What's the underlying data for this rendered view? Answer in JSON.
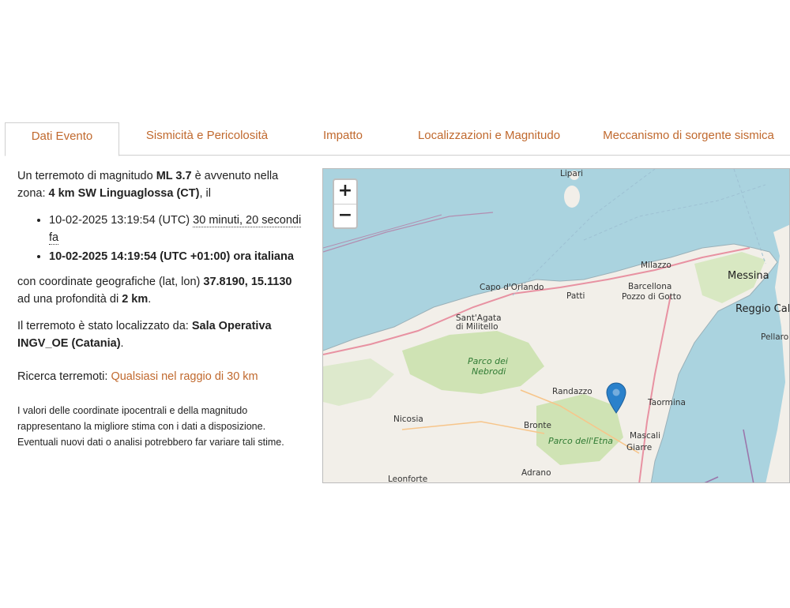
{
  "tabs": [
    {
      "label": "Dati Evento",
      "active": true
    },
    {
      "label": "Sismicità e Pericolosità",
      "active": false
    },
    {
      "label": "Impatto",
      "active": false
    },
    {
      "label": "Localizzazioni e Magnitudo",
      "active": false
    },
    {
      "label": "Meccanismo di sorgente sismica",
      "active": false
    }
  ],
  "event": {
    "intro_pre": "Un terremoto di magnitudo ",
    "magnitude": "ML 3.7",
    "intro_mid": " è avvenuto nella zona: ",
    "zone": "4 km SW Linguaglossa (CT)",
    "intro_post": ", il",
    "utc_time": "10-02-2025 13:19:54 (UTC) ",
    "elapsed": "30 minuti, 20 secondi fa",
    "local_time": "10-02-2025 14:19:54 (UTC +01:00) ora italiana",
    "coords_pre": "con coordinate geografiche (lat, lon) ",
    "coords": "37.8190, 15.1130",
    "depth_pre": " ad una profondità di ",
    "depth": "2 km",
    "depth_post": ".",
    "located_pre": "Il terremoto è stato localizzato da: ",
    "located_by": "Sala Operativa INGV_OE (Catania)",
    "located_post": ".",
    "search_pre": "Ricerca terremoti: ",
    "search_link": "Qualsiasi nel raggio di 30 km",
    "note": "I valori delle coordinate ipocentrali e della magnitudo rappresentano la migliore stima con i dati a disposizione. Eventuali nuovi dati o analisi potrebbero far variare tali stime."
  },
  "map": {
    "zoom_in": "+",
    "zoom_out": "−",
    "labels": {
      "lipari": "Lipari",
      "milazzo": "Milazzo",
      "messina": "Messina",
      "reggio": "Reggio Calab",
      "capo": "Capo d'Orlando",
      "patti": "Patti",
      "barcellona": "Barcellona",
      "pozzo": "Pozzo di Gotto",
      "santagata": "Sant'Agata",
      "militello": "di Militello",
      "pellaro": "Pellaro",
      "nebrodi1": "Parco dei",
      "nebrodi2": "Nebrodi",
      "randazzo": "Randazzo",
      "taormina": "Taormina",
      "bronte": "Bronte",
      "etna": "Parco dell'Etna",
      "mascali": "Mascali",
      "giarre": "Giarre",
      "nicosia": "Nicosia",
      "adrano": "Adrano",
      "leonforte": "Leonforte"
    },
    "marker_color": "#2a81cb",
    "sea_color": "#aad3df",
    "land_color": "#f2efe9",
    "forest_color": "#cfe3b4"
  }
}
